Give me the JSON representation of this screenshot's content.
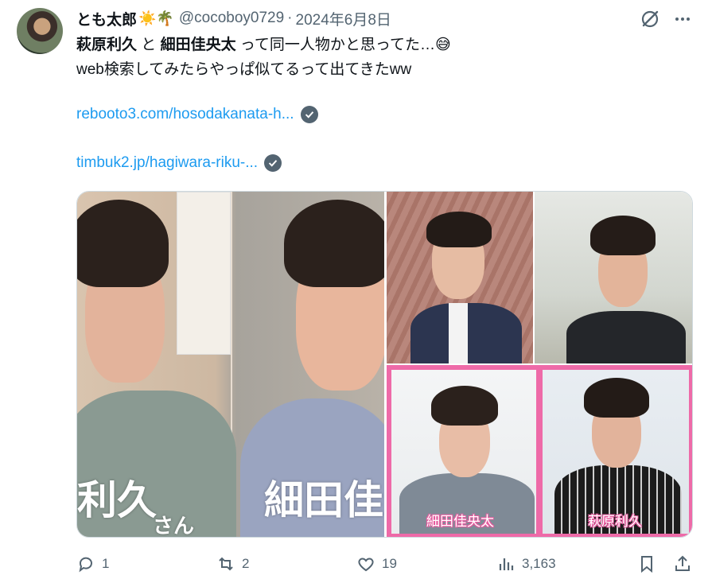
{
  "post": {
    "display_name": "とも太郎",
    "name_emojis": "☀️🌴",
    "handle": "@cocoboy0729",
    "separator": "·",
    "date": "2024年6月8日",
    "text": {
      "name1": "萩原利久",
      "conj": " と ",
      "name2": "細田佳央太",
      "rest1": " って同一人物かと思ってた…😅",
      "line2": "web検索してみたらやっぱ似てるって出てきたww"
    },
    "links": [
      "rebooto3.com/hosodakanata-h...",
      "timbuk2.jp/hagiwara-riku-..."
    ]
  },
  "media": {
    "left_caption_big_1": "利久",
    "left_caption_small": "さん",
    "left_caption_big_2": "細田佳",
    "tag_left": "細田佳央太",
    "tag_right": "萩原利久"
  },
  "actions": {
    "replies": "1",
    "reposts": "2",
    "likes": "19",
    "views": "3,163"
  },
  "icons": [
    "grok-icon",
    "more-icon",
    "verified-icon",
    "reply-icon",
    "repost-icon",
    "like-icon",
    "views-icon",
    "bookmark-icon",
    "share-icon"
  ],
  "colors": {
    "link": "#1d9bf0",
    "muted": "#536471",
    "pink_frame": "#ee6aa8"
  }
}
